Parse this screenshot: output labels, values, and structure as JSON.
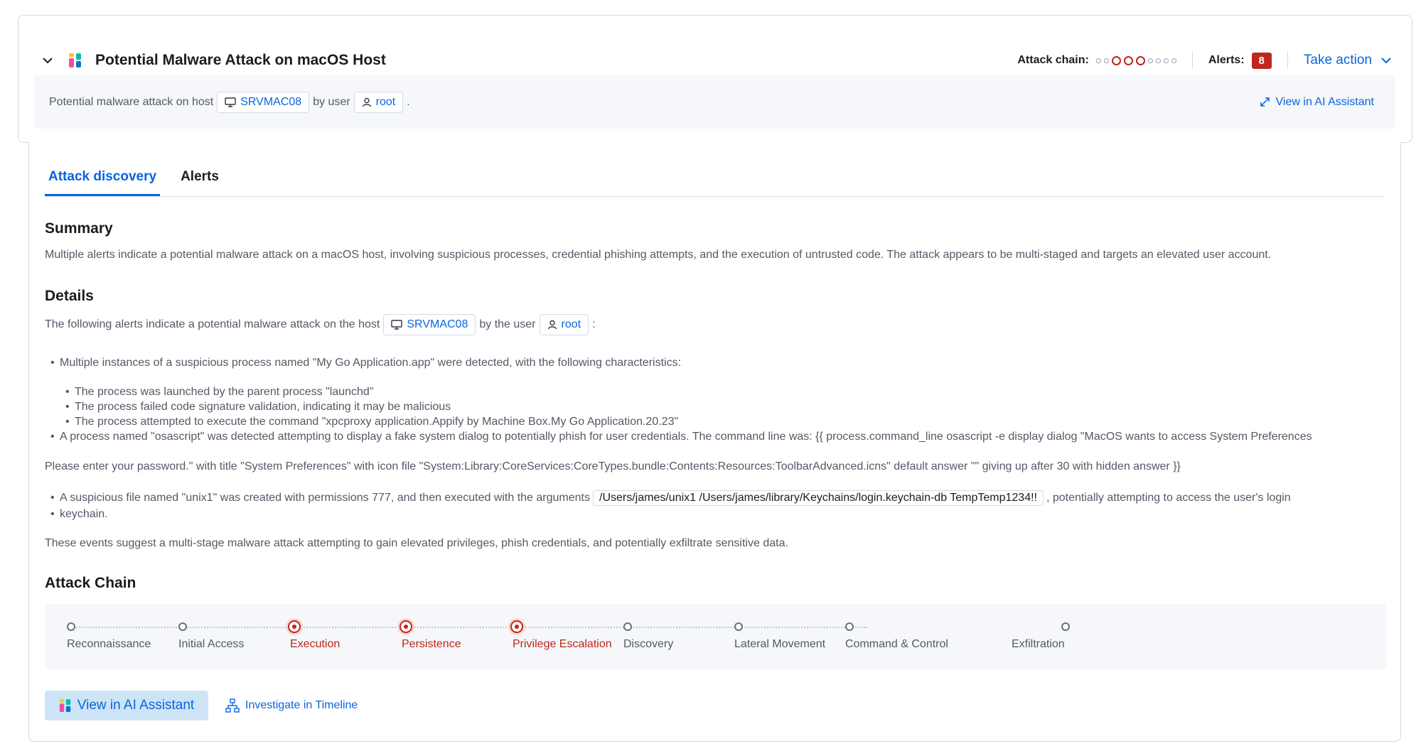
{
  "header": {
    "title": "Potential Malware Attack on macOS Host",
    "attack_chain_label": "Attack chain:",
    "alerts_label": "Alerts:",
    "alerts_count": "8",
    "take_action_label": "Take action"
  },
  "subbar": {
    "prefix": "Potential malware attack on host",
    "host": "SRVMAC08",
    "by_user": "by user",
    "user": "root",
    "suffix": ".",
    "view_ai_label": "View in AI Assistant"
  },
  "tabs": [
    {
      "label": "Attack discovery",
      "active": true
    },
    {
      "label": "Alerts",
      "active": false
    }
  ],
  "summary": {
    "heading": "Summary",
    "text": "Multiple alerts indicate a potential malware attack on a macOS host, involving suspicious processes, credential phishing attempts, and the execution of untrusted code. The attack appears to be multi-staged and targets an elevated user account."
  },
  "details": {
    "heading": "Details",
    "intro_prefix": "The following alerts indicate a potential malware attack on the host",
    "intro_host": "SRVMAC08",
    "intro_mid": "by the user",
    "intro_user": "root",
    "intro_suffix": ":",
    "bullet1": "Multiple instances of a suspicious process named \"My Go Application.app\" were detected, with the following characteristics:",
    "sub1": "The process was launched by the parent process \"launchd\"",
    "sub2": "The process failed code signature validation, indicating it may be malicious",
    "sub3": "The process attempted to execute the command \"xpcproxy application.Appify by Machine Box.My Go Application.20.23\"",
    "bullet2": "A process named \"osascript\" was detected attempting to display a fake system dialog to potentially phish for user credentials. The command line was: {{ process.command_line osascript -e display dialog \"MacOS wants to access System Preferences",
    "para2": "Please enter your password.\" with title \"System Preferences\" with icon file \"System:Library:CoreServices:CoreTypes.bundle:Contents:Resources:ToolbarAdvanced.icns\" default answer \"\" giving up after 30 with hidden answer }}",
    "bullet3_prefix": "A suspicious file named \"unix1\" was created with permissions 777, and then executed with the arguments",
    "bullet3_code": "/Users/james/unix1 /Users/james/library/Keychains/login.keychain-db TempTemp1234!!",
    "bullet3_suffix": ", potentially attempting to access the user's login",
    "bullet3_cont": "keychain.",
    "conclusion": "These events suggest a multi-stage malware attack attempting to gain elevated privileges, phish credentials, and potentially exfiltrate sensitive data."
  },
  "attack_chain": {
    "heading": "Attack Chain",
    "stages": [
      {
        "label": "Reconnaissance",
        "active": false
      },
      {
        "label": "Initial Access",
        "active": false
      },
      {
        "label": "Execution",
        "active": true
      },
      {
        "label": "Persistence",
        "active": true
      },
      {
        "label": "Privilege Escalation",
        "active": true
      },
      {
        "label": "Discovery",
        "active": false
      },
      {
        "label": "Lateral Movement",
        "active": false
      },
      {
        "label": "Command & Control",
        "active": false
      },
      {
        "label": "Exfiltration",
        "active": false
      }
    ]
  },
  "actions": {
    "view_ai_label": "View in AI Assistant",
    "timeline_label": "Investigate in Timeline"
  },
  "colors": {
    "accent": "#0b64dd",
    "danger": "#bd271e",
    "panel_bg": "#f5f7fa"
  }
}
